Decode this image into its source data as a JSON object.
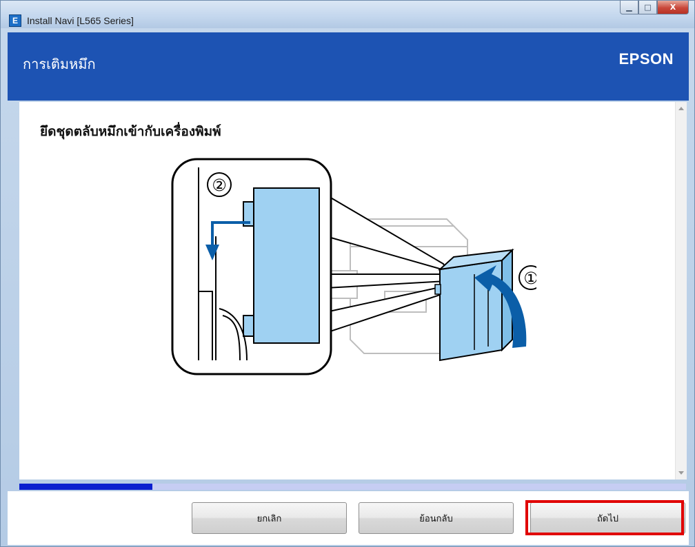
{
  "window": {
    "title": "Install Navi [L565 Series]",
    "icon_letter": "E",
    "buttons": {
      "minimize": "▁",
      "maximize": "□",
      "close": "X"
    }
  },
  "header": {
    "title": "การเติมหมึก",
    "brand": "EPSON",
    "background": "#1d53b3"
  },
  "main": {
    "instruction": "ยึดชุดตลับหมึกเข้ากับเครื่องพิมพ์",
    "illustration": {
      "icon": "printer-ink-tank-attach-illustration",
      "step_labels": [
        "①",
        "②"
      ],
      "tank_color": "#9fd1f2",
      "arrow_color": "#0b5ea8"
    }
  },
  "progress": {
    "value": 0.2,
    "fill_color": "#0a1fcf",
    "track_color": "#c6cdf3"
  },
  "footer": {
    "cancel_label": "ยกเลิก",
    "back_label": "ย้อนกลับ",
    "next_label": "ถัดไป",
    "highlight_color": "#e00000"
  }
}
